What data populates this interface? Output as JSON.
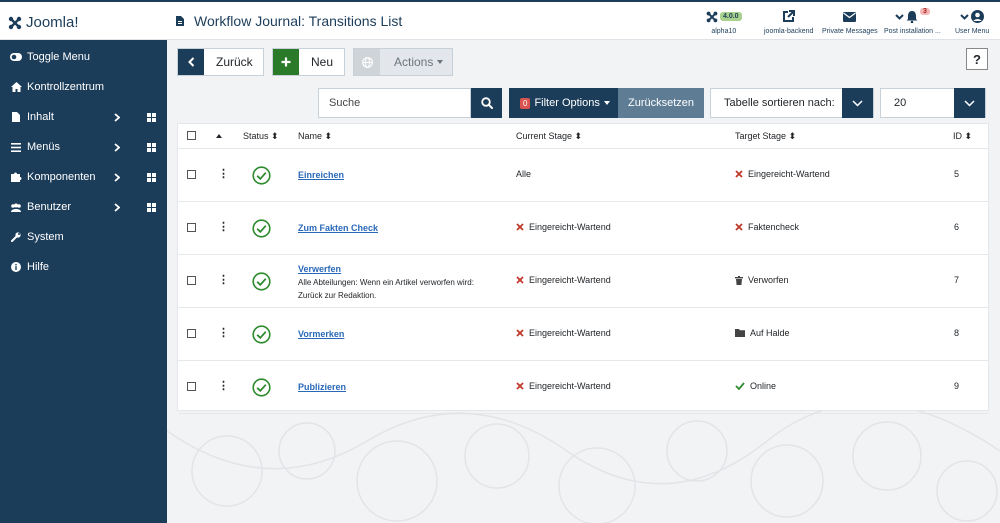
{
  "header": {
    "logo_text": "Joomla!",
    "page_title": "Workflow Journal: Transitions List",
    "items": [
      {
        "label": "alpha10",
        "badge": "4.0.0",
        "icon": "joomla-icon"
      },
      {
        "label": "joomla-backend",
        "icon": "external-link-icon"
      },
      {
        "label": "Private Messages",
        "icon": "envelope-icon"
      },
      {
        "label": "Post installation ...",
        "icon": "bell-icon",
        "badge": "3"
      },
      {
        "label": "User Menu",
        "icon": "user-icon"
      }
    ]
  },
  "sidebar": {
    "items": [
      {
        "label": "Toggle Menu",
        "icon": "toggle-icon"
      },
      {
        "label": "Kontrollzentrum",
        "icon": "home-icon"
      },
      {
        "label": "Inhalt",
        "icon": "file-icon",
        "has_submenu": true
      },
      {
        "label": "Menüs",
        "icon": "list-icon",
        "has_submenu": true
      },
      {
        "label": "Komponenten",
        "icon": "puzzle-icon",
        "has_submenu": true
      },
      {
        "label": "Benutzer",
        "icon": "users-icon",
        "has_submenu": true
      },
      {
        "label": "System",
        "icon": "wrench-icon"
      },
      {
        "label": "Hilfe",
        "icon": "info-icon"
      }
    ]
  },
  "toolbar": {
    "back_label": "Zurück",
    "new_label": "Neu",
    "actions_label": "Actions",
    "help_label": "?"
  },
  "filters": {
    "search_placeholder": "Suche",
    "filter_options_label": "Filter Options",
    "filter_count": "0",
    "reset_label": "Zurücksetzen",
    "sort_label": "Tabelle sortieren nach:",
    "limit_value": "20"
  },
  "table": {
    "columns": {
      "status": "Status",
      "name": "Name",
      "current_stage": "Current Stage",
      "target_stage": "Target Stage",
      "id": "ID"
    },
    "rows": [
      {
        "name": "Einreichen",
        "description": "",
        "current_stage": "Alle",
        "current_icon": "none",
        "target_stage": "Eingereicht-Wartend",
        "target_icon": "times-icon",
        "id": "5"
      },
      {
        "name": "Zum Fakten Check",
        "description": "",
        "current_stage": "Eingereicht-Wartend",
        "current_icon": "times-icon",
        "target_stage": "Faktencheck",
        "target_icon": "times-icon",
        "id": "6"
      },
      {
        "name": "Verwerfen",
        "description": "Alle Abteilungen: Wenn ein Artikel verworfen wird: Zurück zur Redaktion.",
        "current_stage": "Eingereicht-Wartend",
        "current_icon": "times-icon",
        "target_stage": "Verworfen",
        "target_icon": "trash-icon",
        "id": "7"
      },
      {
        "name": "Vormerken",
        "description": "",
        "current_stage": "Eingereicht-Wartend",
        "current_icon": "times-icon",
        "target_stage": "Auf Halde",
        "target_icon": "folder-icon",
        "id": "8"
      },
      {
        "name": "Publizieren",
        "description": "",
        "current_stage": "Eingereicht-Wartend",
        "current_icon": "times-icon",
        "target_stage": "Online",
        "target_icon": "check-icon",
        "id": "9"
      }
    ]
  },
  "colors": {
    "primary": "#1c3d5a",
    "success": "#2e8b2e",
    "danger": "#c0392b",
    "link": "#2a69b8"
  }
}
